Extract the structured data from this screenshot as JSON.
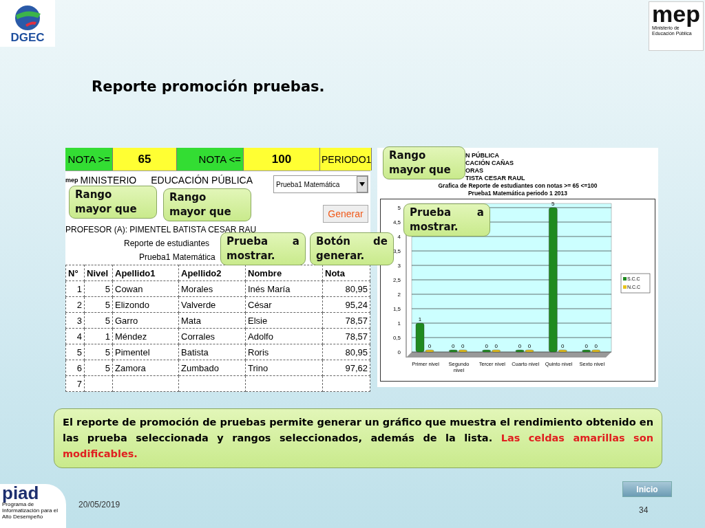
{
  "header": {
    "left_logo": {
      "text": "DGEC"
    },
    "right_logo": {
      "mark": "mep",
      "caption": "Ministerio de Educación Pública"
    }
  },
  "title": "Reporte promoción pruebas.",
  "sheet": {
    "filters": [
      {
        "kind": "label",
        "text": "NOTA >="
      },
      {
        "kind": "input",
        "text": "65"
      },
      {
        "kind": "label",
        "text": "NOTA <="
      },
      {
        "kind": "input",
        "text": "100"
      },
      {
        "kind": "period",
        "text": "PERIODO1"
      }
    ],
    "logo_text": "mep",
    "header_lines": [
      "MINISTERIO",
      "EDUCACIÓN PÚBLICA"
    ],
    "teacher": "PROFESOR (A): PIMENTEL BATISTA CESAR RAU",
    "report_title": "Reporte de estudiantes",
    "report_subtitle": "Prueba1 Matemática",
    "test_select": {
      "value": "Prueba1 Matemática"
    },
    "generate_button": "Generar",
    "table": {
      "columns": [
        "N°",
        "Nivel",
        "Apellido1",
        "Apellido2",
        "Nombre",
        "Nota"
      ],
      "rows": [
        [
          "1",
          "5",
          "Cowan",
          "Morales",
          "Inés María",
          "80,95"
        ],
        [
          "2",
          "5",
          "Elizondo",
          "Valverde",
          "César",
          "95,24"
        ],
        [
          "3",
          "5",
          "Garro",
          "Mata",
          "Elsie",
          "78,57"
        ],
        [
          "4",
          "1",
          "Méndez",
          "Corrales",
          "Adolfo",
          "78,57"
        ],
        [
          "5",
          "5",
          "Pimentel",
          "Batista",
          "Roris",
          "80,95"
        ],
        [
          "6",
          "5",
          "Zamora",
          "Zumbado",
          "Trino",
          "97,62"
        ],
        [
          "7"
        ]
      ]
    }
  },
  "chart": {
    "header_lines": [
      "N PÚBLICA",
      "CACIÓN CAÑAS",
      "ORAS",
      "TISTA CESAR RAUL"
    ],
    "subtitle": "Prueba1 Matemática periodo 1 2013",
    "chart_data": {
      "type": "bar",
      "title": "Grafica de Reporte de estudiantes con notas >= 65 <=100",
      "categories": [
        "Primer nivel",
        "Segundo nivel",
        "Tercer nivel",
        "Cuarto nivel",
        "Quinto nivel",
        "Sexto nivel"
      ],
      "series": [
        {
          "name": "S.C.C",
          "color": "#1f8a1f",
          "values": [
            1,
            0,
            0,
            0,
            5,
            0
          ]
        },
        {
          "name": "N.C.C",
          "color": "#e8c21a",
          "values": [
            0,
            0,
            0,
            0,
            0,
            0
          ]
        }
      ],
      "ylim": [
        0,
        5
      ],
      "grid": true,
      "legend": true,
      "yticks": [
        0,
        {
          "value": 0.5,
          "label": "0,5"
        },
        1,
        {
          "value": 1.5,
          "label": "1,5"
        },
        2,
        {
          "value": 2.5,
          "label": "2,5"
        },
        3,
        {
          "value": 3.5,
          "label": "3,5"
        },
        4,
        {
          "value": 4.5,
          "label": "4,5"
        },
        5
      ],
      "data_labels": true
    }
  },
  "callouts": [
    {
      "text": "Rango mayor que"
    },
    {
      "text": "Rango mayor que"
    },
    {
      "text": "Rango mayor que"
    },
    {
      "text": "Prueba a mostrar."
    },
    {
      "text": "Botón de generar."
    },
    {
      "text": "Prueba a mostrar."
    }
  ],
  "note": {
    "text": "El reporte de promoción de pruebas permite generar un gráfico que muestra el rendimiento obtenido en las prueba seleccionada y rangos seleccionados, además de la lista.",
    "highlight": "Las celdas amarillas son modificables."
  },
  "footer": {
    "logo": "piad",
    "logo_caption": "Programa de Informatización para el Alto Desempeño",
    "date": "20/05/2019",
    "page": "34",
    "home_button": "Inicio"
  }
}
